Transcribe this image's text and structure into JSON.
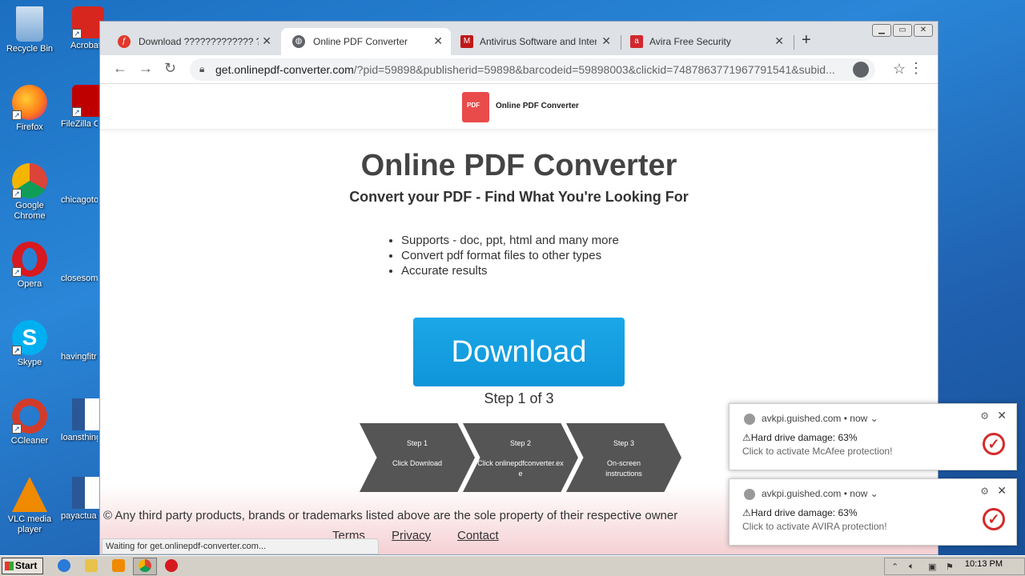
{
  "desktop": {
    "col1": [
      {
        "label": "Recycle Bin",
        "color": "#7aa8d6"
      },
      {
        "label": "Firefox",
        "color": "#ff7a1a"
      },
      {
        "label": "Google Chrome",
        "color": "#3fa34d"
      },
      {
        "label": "Opera",
        "color": "#d71920"
      },
      {
        "label": "Skype",
        "color": "#00aff0"
      },
      {
        "label": "CCleaner",
        "color": "#d23b2a"
      },
      {
        "label": "VLC media player",
        "color": "#f08a00"
      }
    ],
    "col2": [
      {
        "label": "Acrobat Reader",
        "color": "#d7261e"
      },
      {
        "label": "FileZilla C",
        "color": "#bf0000"
      },
      {
        "label": "chicagoto",
        "color": ""
      },
      {
        "label": "closesome",
        "color": ""
      },
      {
        "label": "havingfitr",
        "color": ""
      },
      {
        "label": "loansthing",
        "color": "#2b5797"
      },
      {
        "label": "payactua",
        "color": "#2b5797"
      }
    ]
  },
  "browser": {
    "tabs": [
      {
        "title": "Download ????????????? ??????",
        "icon": "flash-icon"
      },
      {
        "title": "Online PDF Converter",
        "icon": "globe-icon",
        "active": true
      },
      {
        "title": "Antivirus Software and Internet",
        "icon": "mcafee-icon"
      },
      {
        "title": "Avira Free Security",
        "icon": "avira-icon"
      }
    ],
    "new_tab": "+",
    "url_host": "get.onlinepdf-converter.com",
    "url_rest": "/?pid=59898&publisherid=59898&barcodeid=59898003&clickid=7487863771967791541&subid..."
  },
  "page": {
    "site_name": "Online PDF Converter",
    "title": "Online PDF Converter",
    "subtitle": "Convert your PDF - Find What You're Looking For",
    "features": [
      "Supports - doc, ppt, html and many more",
      "Convert pdf format files to other types",
      "Accurate results"
    ],
    "download_label": "Download",
    "step_label": "Step 1 of 3",
    "steps": [
      {
        "title": "Step 1",
        "desc": "Click Download"
      },
      {
        "title": "Step 2",
        "desc": "Click onlinepdfconverter.exe"
      },
      {
        "title": "Step 3",
        "desc": "On-screen instructions"
      }
    ],
    "copyright": "© Any third party products, brands or trademarks listed above are the sole property of their respective owner",
    "links": [
      "Terms",
      "Privacy",
      "Contact"
    ],
    "status": "Waiting for get.onlinepdf-converter.com..."
  },
  "notifications": [
    {
      "source": "avkpi.guished.com",
      "time": "• now ⌄",
      "title": "⚠Hard drive damage: 63%",
      "body": "Click to activate McAfee protection!"
    },
    {
      "source": "avkpi.guished.com",
      "time": "• now ⌄",
      "title": "⚠Hard drive damage: 63%",
      "body": "Click to activate AVIRA protection!"
    }
  ],
  "taskbar": {
    "start_label": "Start",
    "clock": "10:13 PM"
  }
}
